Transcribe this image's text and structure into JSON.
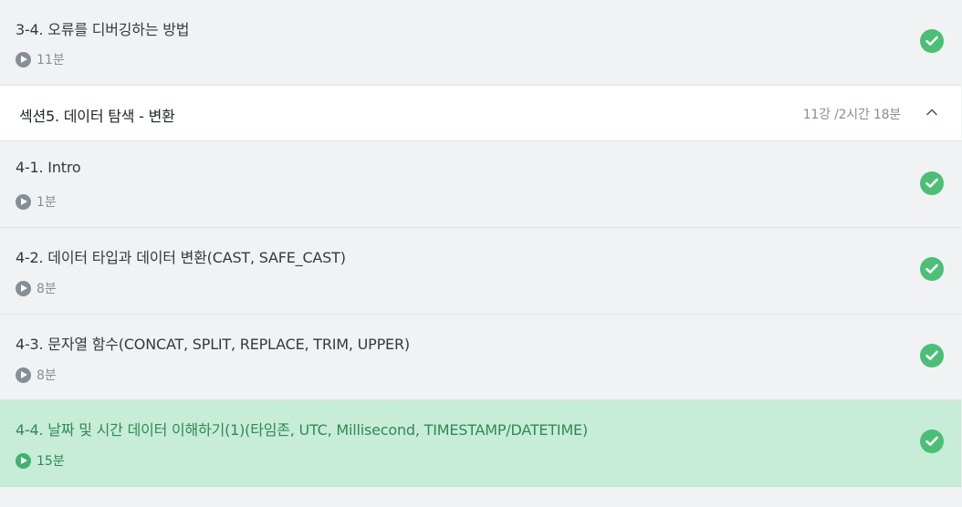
{
  "lectures_before": [
    {
      "title": "3-4. 오류를 디버깅하는 방법",
      "duration": "11분",
      "completed": true
    }
  ],
  "section": {
    "title": "섹션5. 데이터 탐색 - 변환",
    "meta": "11강 /2시간 18분",
    "expanded": true
  },
  "lectures": [
    {
      "title": "4-1. Intro",
      "duration": "1분",
      "completed": true
    },
    {
      "title": "4-2. 데이터 타입과 데이터 변환(CAST, SAFE_CAST)",
      "duration": "8분",
      "completed": true
    },
    {
      "title": "4-3. 문자열 함수(CONCAT, SPLIT, REPLACE, TRIM, UPPER)",
      "duration": "8분",
      "completed": true
    },
    {
      "title": "4-4. 날짜 및 시간 데이터 이해하기(1)(타임존, UTC, Millisecond, TIMESTAMP/DATETIME)",
      "duration": "15분",
      "completed": true,
      "active": true
    }
  ],
  "icons": {
    "play": "play-circle-icon",
    "check": "check-circle-icon",
    "collapse": "chevron-up-icon"
  },
  "colors": {
    "active_bg": "#c7ecd8",
    "check_green": "#4bbf75",
    "active_text": "#2f8a56"
  }
}
